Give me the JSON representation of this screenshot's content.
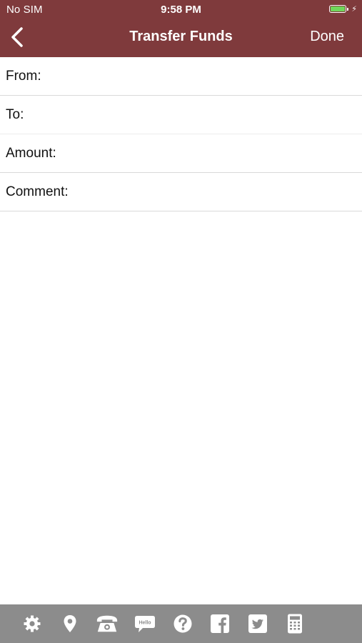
{
  "status_bar": {
    "carrier": "No SIM",
    "time": "9:58 PM",
    "battery_level": 1.0,
    "battery_color": "#6fd65a",
    "charging_icon": "bolt-icon"
  },
  "nav": {
    "back_icon": "chevron-left-icon",
    "title": "Transfer Funds",
    "done_label": "Done",
    "background": "#7f3a3c"
  },
  "form": {
    "from_label": "From:",
    "to_label": "To:",
    "amount_label": "Amount:",
    "comment_label": "Comment:",
    "from_value": "",
    "to_value": "",
    "amount_value": "",
    "comment_value": ""
  },
  "toolbar": {
    "background": "#8c8c8c",
    "bubble_text": "Hello",
    "icons": [
      "gear-icon",
      "location-pin-icon",
      "phone-icon",
      "chat-bubble-icon",
      "help-icon",
      "facebook-icon",
      "twitter-icon",
      "calculator-icon"
    ]
  }
}
